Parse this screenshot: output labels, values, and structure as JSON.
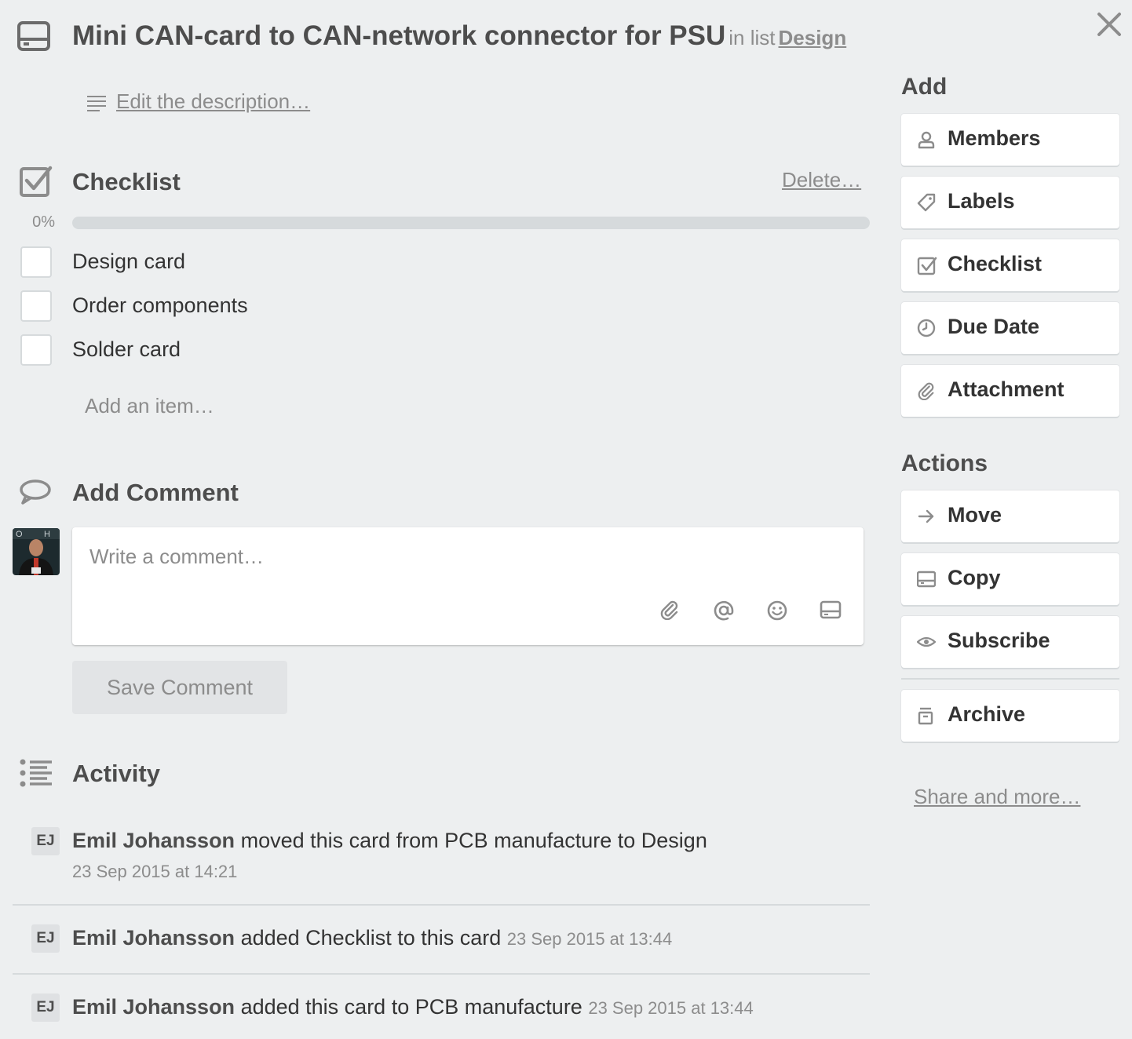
{
  "card": {
    "title": "Mini CAN-card to CAN-network connector for PSU",
    "in_list_prefix": "in list",
    "list_name": "Design",
    "description_link": "Edit the description…"
  },
  "checklist": {
    "title": "Checklist",
    "delete_link": "Delete…",
    "progress_label": "0%",
    "progress_fraction": 0,
    "items": [
      {
        "label": "Design card",
        "checked": false
      },
      {
        "label": "Order components",
        "checked": false
      },
      {
        "label": "Solder card",
        "checked": false
      }
    ],
    "add_item": "Add an item…"
  },
  "comment": {
    "title": "Add Comment",
    "placeholder": "Write a comment…",
    "toolbar_icons": [
      "paperclip-icon",
      "at-sign-icon",
      "emoji-icon",
      "card-icon"
    ],
    "save_label": "Save Comment"
  },
  "activity": {
    "title": "Activity",
    "entries": [
      {
        "initials": "EJ",
        "user": "Emil Johansson",
        "text": "moved this card from PCB manufacture to Design",
        "date": "23 Sep 2015 at 14:21"
      },
      {
        "initials": "EJ",
        "user": "Emil Johansson",
        "text": "added Checklist to this card",
        "date": "23 Sep 2015 at 13:44"
      },
      {
        "initials": "EJ",
        "user": "Emil Johansson",
        "text": "added this card to PCB manufacture",
        "date": "23 Sep 2015 at 13:44"
      }
    ]
  },
  "sidebar": {
    "add_heading": "Add",
    "add_buttons": [
      {
        "label": "Members",
        "icon": "person-icon"
      },
      {
        "label": "Labels",
        "icon": "tag-icon"
      },
      {
        "label": "Checklist",
        "icon": "checkbox-icon"
      },
      {
        "label": "Due Date",
        "icon": "clock-icon"
      },
      {
        "label": "Attachment",
        "icon": "paperclip-icon"
      }
    ],
    "actions_heading": "Actions",
    "action_buttons": [
      {
        "label": "Move",
        "icon": "arrow-right-icon"
      },
      {
        "label": "Copy",
        "icon": "card-icon"
      },
      {
        "label": "Subscribe",
        "icon": "eye-icon"
      },
      {
        "label": "Archive",
        "icon": "archive-icon"
      }
    ],
    "share_link": "Share and more…"
  },
  "colors": {
    "background": "#edeff0",
    "progress_fill": "#5aac44",
    "muted_text": "#8c8c8c"
  }
}
